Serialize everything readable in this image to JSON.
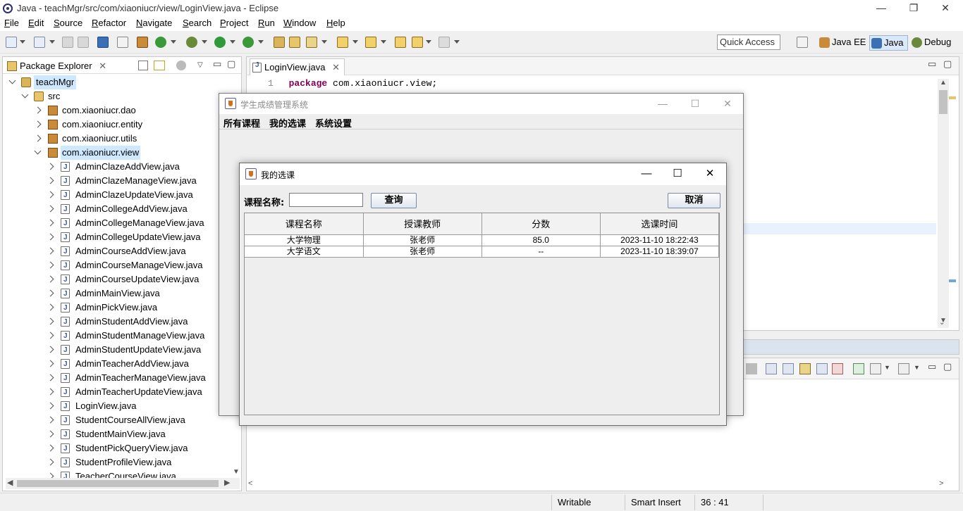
{
  "window": {
    "title": "Java - teachMgr/src/com/xiaoniucr/view/LoginView.java - Eclipse",
    "minimize": "—",
    "maximize": "❐",
    "close": "✕"
  },
  "menubar": [
    "File",
    "Edit",
    "Source",
    "Refactor",
    "Navigate",
    "Search",
    "Project",
    "Run",
    "Window",
    "Help"
  ],
  "toolbar": {
    "quick_access": "Quick Access",
    "perspectives": [
      "Java EE",
      "Java",
      "Debug"
    ]
  },
  "package_explorer": {
    "tab_label": "Package Explorer",
    "project": "teachMgr",
    "src_folder": "src",
    "packages": [
      "com.xiaoniucr.dao",
      "com.xiaoniucr.entity",
      "com.xiaoniucr.utils",
      "com.xiaoniucr.view"
    ],
    "files": [
      "AdminClazeAddView.java",
      "AdminClazeManageView.java",
      "AdminClazeUpdateView.java",
      "AdminCollegeAddView.java",
      "AdminCollegeManageView.java",
      "AdminCollegeUpdateView.java",
      "AdminCourseAddView.java",
      "AdminCourseManageView.java",
      "AdminCourseUpdateView.java",
      "AdminMainView.java",
      "AdminPickView.java",
      "AdminStudentAddView.java",
      "AdminStudentManageView.java",
      "AdminStudentUpdateView.java",
      "AdminTeacherAddView.java",
      "AdminTeacherManageView.java",
      "AdminTeacherUpdateView.java",
      "LoginView.java",
      "StudentCourseAllView.java",
      "StudentMainView.java",
      "StudentPickQueryView.java",
      "StudentProfileView.java",
      "TeacherCourseView.java"
    ]
  },
  "editor": {
    "tab_label": "LoginView.java",
    "line_number": "1",
    "keyword": "package",
    "code_rest": " com.xiaoniucr.view;"
  },
  "statusbar": {
    "writable": "Writable",
    "insert_mode": "Smart Insert",
    "position": "36 : 41"
  },
  "main_window": {
    "title": "学生成绩管理系统",
    "menus": [
      "所有课程",
      "我的选课",
      "系统设置"
    ]
  },
  "dialog": {
    "title": "我的选课",
    "course_label": "课程名称:",
    "course_input_value": "",
    "query_button": "查询",
    "cancel_button": "取消",
    "table": {
      "headers": [
        "课程名称",
        "授课教师",
        "分数",
        "选课时间"
      ],
      "rows": [
        [
          "大学物理",
          "张老师",
          "85.0",
          "2023-11-10 18:22:43"
        ],
        [
          "大学语文",
          "张老师",
          "--",
          "2023-11-10 18:39:07"
        ]
      ]
    }
  }
}
